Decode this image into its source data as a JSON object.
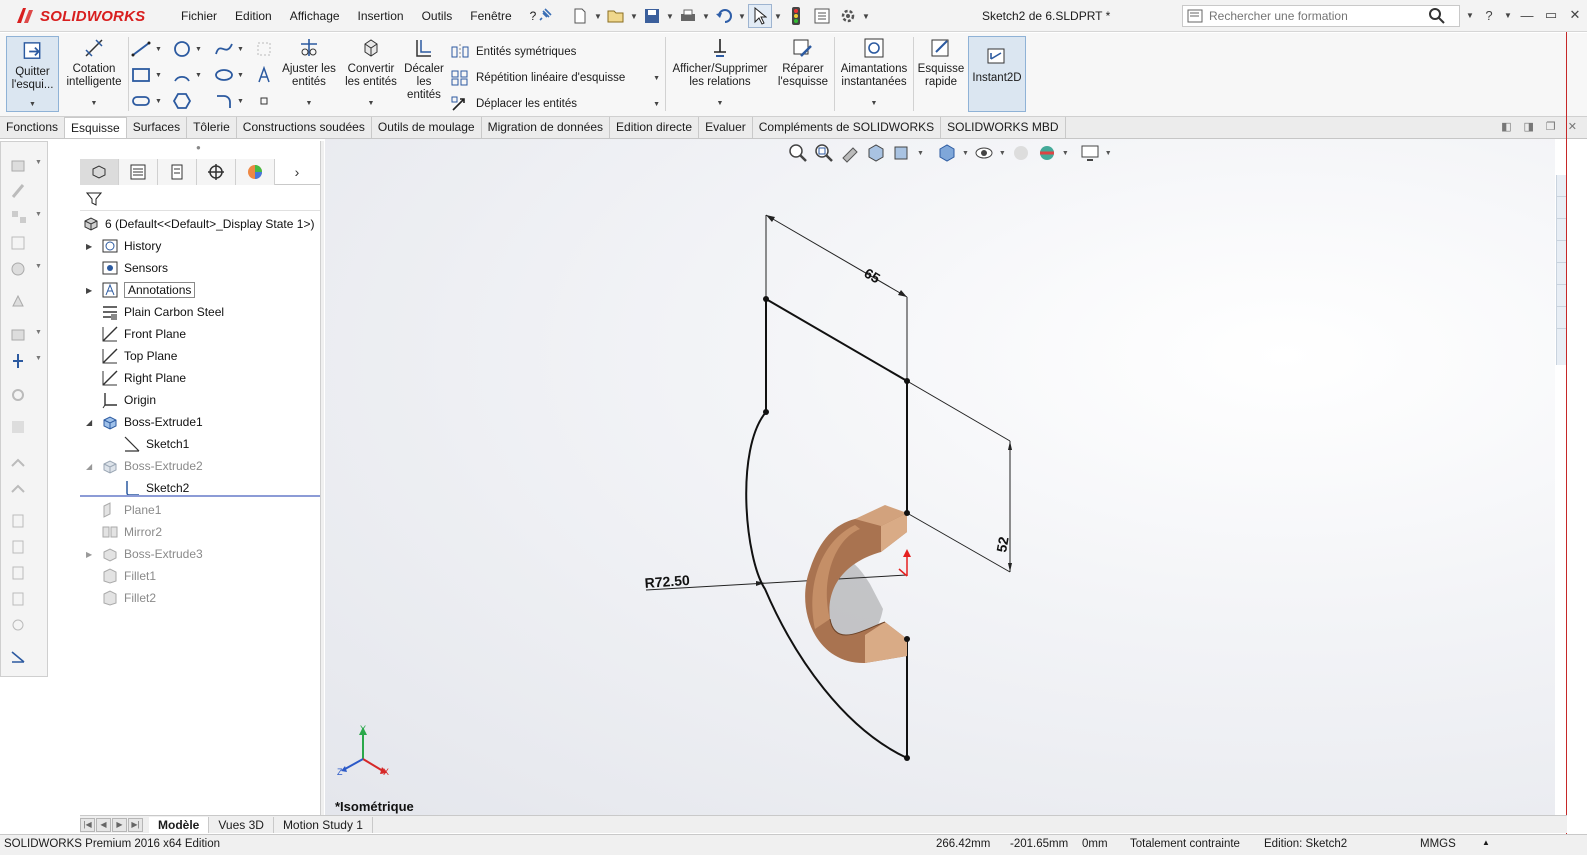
{
  "app": {
    "brand": "SOLIDWORKS",
    "document_title": "Sketch2 de 6.SLDPRT *",
    "brand_color": "#d81e1e"
  },
  "menu": [
    "Fichier",
    "Edition",
    "Affichage",
    "Insertion",
    "Outils",
    "Fenêtre",
    "?"
  ],
  "search": {
    "placeholder": "Rechercher une formation"
  },
  "ribbon": {
    "exit_sketch": "Quitter l'esqui...",
    "smart_dimension": [
      "Cotation",
      "intelligente"
    ],
    "trim": [
      "Ajuster les",
      "entités"
    ],
    "convert": [
      "Convertir",
      "les entités"
    ],
    "offset": [
      "Décaler",
      "les",
      "entités"
    ],
    "mirror": "Entités symétriques",
    "linear_pattern": "Répétition linéaire d'esquisse",
    "move": "Déplacer les entités",
    "relations": [
      "Afficher/Supprimer",
      "les relations"
    ],
    "repair": [
      "Réparer",
      "l'esquisse"
    ],
    "snaps": [
      "Aimantations",
      "instantanées"
    ],
    "rapid_sketch": [
      "Esquisse",
      "rapide"
    ],
    "instant2d": "Instant2D"
  },
  "tabs": [
    "Fonctions",
    "Esquisse",
    "Surfaces",
    "Tôlerie",
    "Constructions soudées",
    "Outils de moulage",
    "Migration de données",
    "Edition directe",
    "Evaluer",
    "Compléments de SOLIDWORKS",
    "SOLIDWORKS MBD"
  ],
  "active_tab": "Esquisse",
  "tree": {
    "root": "6  (Default<<Default>_Display State 1>)",
    "items": [
      {
        "label": "History",
        "expander": true,
        "grey": false
      },
      {
        "label": "Sensors",
        "expander": false,
        "grey": false
      },
      {
        "label": "Annotations",
        "expander": true,
        "grey": false
      },
      {
        "label": "Plain Carbon Steel",
        "expander": false,
        "grey": false
      },
      {
        "label": "Front Plane",
        "expander": false,
        "grey": false
      },
      {
        "label": "Top Plane",
        "expander": false,
        "grey": false
      },
      {
        "label": "Right Plane",
        "expander": false,
        "grey": false
      },
      {
        "label": "Origin",
        "expander": false,
        "grey": false
      },
      {
        "label": "Boss-Extrude1",
        "expander": true,
        "grey": false
      },
      {
        "label": "Sketch1",
        "expander": false,
        "grey": false
      },
      {
        "label": "Boss-Extrude2",
        "expander": true,
        "grey": true
      },
      {
        "label": "Sketch2",
        "expander": false,
        "grey": false
      },
      {
        "label": "Plane1",
        "expander": false,
        "grey": true
      },
      {
        "label": "Mirror2",
        "expander": false,
        "grey": true
      },
      {
        "label": "Boss-Extrude3",
        "expander": true,
        "grey": true
      },
      {
        "label": "Fillet1",
        "expander": false,
        "grey": true
      },
      {
        "label": "Fillet2",
        "expander": false,
        "grey": true
      }
    ]
  },
  "viewport": {
    "view_name": "*Isométrique",
    "dim_65": "65",
    "dim_52": "52",
    "dim_r": "R72.50",
    "axis_x": "X",
    "axis_y": "Y",
    "axis_z": "Z",
    "part_color": "#b07a55"
  },
  "bottom_tabs": [
    "Modèle",
    "Vues 3D",
    "Motion Study 1"
  ],
  "status": {
    "product": "SOLIDWORKS Premium 2016 x64 Edition",
    "x": "266.42mm",
    "y": "-201.65mm",
    "z": "0mm",
    "state": "Totalement contrainte",
    "editing": "Edition: Sketch2",
    "units": "MMGS"
  }
}
